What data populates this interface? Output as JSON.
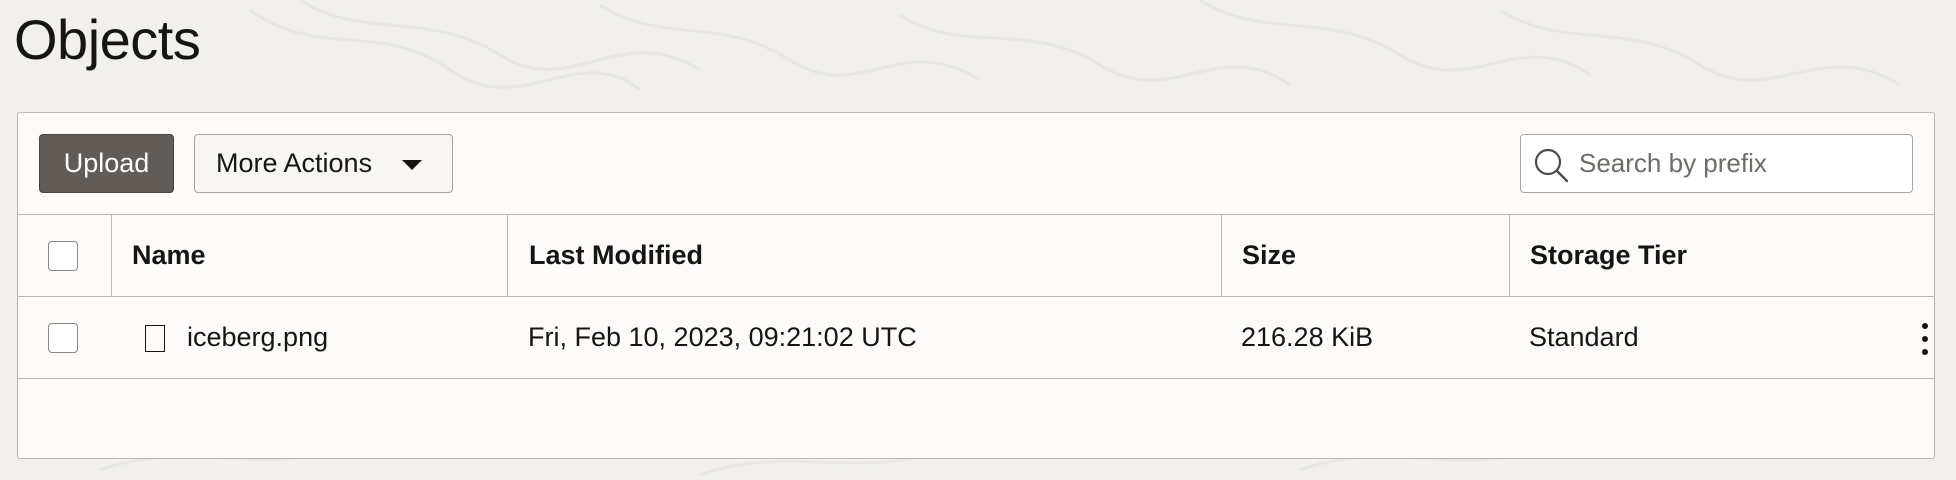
{
  "page": {
    "title": "Objects"
  },
  "toolbar": {
    "upload_label": "Upload",
    "more_actions_label": "More Actions",
    "search_placeholder": "Search by prefix"
  },
  "table": {
    "columns": [
      "Name",
      "Last Modified",
      "Size",
      "Storage Tier"
    ],
    "rows": [
      {
        "name": "iceberg.png",
        "last_modified": "Fri, Feb 10, 2023, 09:21:02 UTC",
        "size": "216.28 KiB",
        "storage_tier": "Standard"
      }
    ]
  },
  "icons": {
    "search": "search-icon",
    "dropdown": "caret-down-icon",
    "file": "file-icon",
    "row_actions": "kebab-menu-icon"
  },
  "colors": {
    "upload_button": "#615c57",
    "page_background": "#f1f0ee",
    "panel_background": "#fcfbfa",
    "border": "#bcb8b2"
  }
}
